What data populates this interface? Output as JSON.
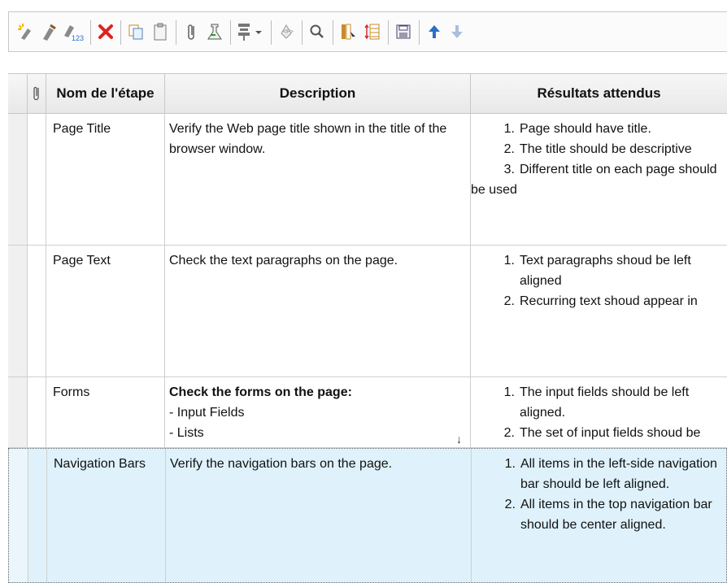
{
  "toolbar": {
    "buttons": [
      {
        "name": "new-step-icon",
        "label": ""
      },
      {
        "name": "edit-step-icon",
        "label": ""
      },
      {
        "name": "renumber-steps-icon",
        "label": "123"
      },
      {
        "name": "delete-icon",
        "label": ""
      },
      {
        "name": "copy-icon",
        "label": ""
      },
      {
        "name": "paste-icon",
        "label": ""
      },
      {
        "name": "attachment-icon",
        "label": ""
      },
      {
        "name": "call-test-icon",
        "label": ""
      },
      {
        "name": "parameters-icon",
        "label": ""
      },
      {
        "name": "insert-parameter-icon",
        "label": ""
      },
      {
        "name": "find-icon",
        "label": ""
      },
      {
        "name": "select-columns-icon",
        "label": ""
      },
      {
        "name": "grid-filter-icon",
        "label": ""
      },
      {
        "name": "save-icon",
        "label": ""
      },
      {
        "name": "move-up-icon",
        "label": ""
      },
      {
        "name": "move-down-icon",
        "label": ""
      }
    ]
  },
  "grid": {
    "columns": {
      "attachment": "",
      "step_name": "Nom de l'étape",
      "description": "Description",
      "expected": "Résultats attendus"
    },
    "rows": [
      {
        "name": "Page Title",
        "description": "Verify the Web page title shown in the title of the browser window.",
        "expected_items": [
          {
            "num": "1.",
            "text": "Page should have title."
          },
          {
            "num": "2.",
            "text": "The title should be descriptive"
          }
        ],
        "expected_item3_num": "3.",
        "expected_item3_line1": "Different title on each page should",
        "expected_item3_line2": "be used"
      },
      {
        "name": "Page Text",
        "description": "Check the text paragraphs on the page.",
        "expected_items": [
          {
            "num": "1.",
            "text": "Text paragraphs shoud be left aligned"
          },
          {
            "num": "2.",
            "text": "Recurring text shoud appear in"
          }
        ]
      },
      {
        "name": "Forms",
        "description_bold": "Check the forms on the page:",
        "description_lines": [
          "- Input Fields",
          "- Lists"
        ],
        "scroll_indicator": "↓",
        "expected_items": [
          {
            "num": "1.",
            "text": "The input fields should be left aligned."
          },
          {
            "num": "2.",
            "text": "The set of input fields shoud be"
          }
        ]
      },
      {
        "name": "Navigation Bars",
        "description": "Verify the navigation bars on the page.",
        "expected_items": [
          {
            "num": "1.",
            "text": "All items in the left-side navigation bar should be left aligned."
          },
          {
            "num": "2.",
            "text": "All items in the top navigation bar should be center aligned."
          }
        ],
        "selected": true
      }
    ]
  },
  "colors": {
    "selected_row": "#dff2fb",
    "delete": "#e02020",
    "accent_blue": "#2b6fc4"
  }
}
